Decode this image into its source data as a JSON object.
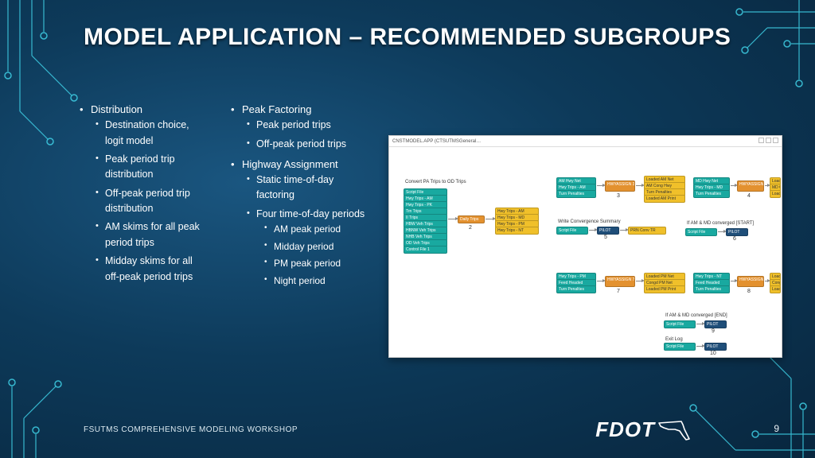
{
  "title": "MODEL APPLICATION – RECOMMENDED SUBGROUPS",
  "columns": [
    {
      "heading": "Distribution",
      "items": [
        "Destination choice, logit model",
        "Peak period trip distribution",
        "Off-peak period trip distribution",
        "AM skims for all peak period trips",
        "Midday skims for all off-peak period trips"
      ]
    },
    {
      "heading": "Peak Factoring",
      "items": [
        "Peak period trips",
        "Off-peak period trips"
      ]
    },
    {
      "heading": "Highway Assignment",
      "items": [
        "Static time-of-day factoring",
        {
          "text": "Four time-of-day periods",
          "sub": [
            "AM peak period",
            "Midday period",
            "PM peak period",
            "Night period"
          ]
        }
      ]
    }
  ],
  "flowchart": {
    "window_title": "CNSTMODEL.APP (CTSUTMSGeneral…",
    "sections": {
      "convert": {
        "title": "Convert PA Trips to OD Trips",
        "inputs": [
          "Script File",
          "Hwy Trips - AM",
          "Hwy Trips - PK",
          "Trn Trips",
          "II Trips",
          "HBW Veh Trips",
          "HBNW Veh Trips",
          "NHB Veh Trips",
          "OD Veh Trips",
          "Control File 1"
        ],
        "proc": "Daily Trips",
        "outputs": [
          "Hwy Trips - AM",
          "Hwy Trips - MD",
          "Hwy Trips - PM",
          "Hwy Trips - NT"
        ]
      },
      "top_right_1": {
        "inputs": [
          "AM Hwy Net",
          "Hwy Trips - AM",
          "Turn Penalties"
        ],
        "proc": "HWYASSIGN 3",
        "outputs": [
          "Loaded AM Net",
          "AM Cong Hwy",
          "Turn Penalties",
          "Loaded AM Print"
        ]
      },
      "top_right_2": {
        "inputs": [
          "MD Hwy Net",
          "Hwy Trips - MD",
          "Turn Penalties"
        ],
        "proc": "HWYASSIGN 4",
        "outputs": [
          "Loaded MD Net",
          "MD Cong Hwy",
          "Loaded MD Print"
        ]
      },
      "convergence": {
        "title": "Write Convergence Summary",
        "inputs": [
          "Script File"
        ],
        "proc": "PILOT",
        "outputs": [
          "PRN Conv TR"
        ]
      },
      "start": {
        "title": "If AM & MD converged [START]",
        "inputs": [
          "Script File"
        ],
        "proc": "PILOT"
      },
      "bottom_1": {
        "inputs": [
          "Hwy Trips - PM",
          "Feed Headed",
          "Turn Penalties"
        ],
        "proc": "HWYASSIGN 7",
        "outputs": [
          "Loaded PM Net",
          "Congd PM Net",
          "Loaded PM Print"
        ]
      },
      "bottom_2": {
        "inputs": [
          "Hwy Trips - NT",
          "Feed Headed",
          "Turn Penalties"
        ],
        "proc": "HWYASSIGN 8",
        "outputs": [
          "Loaded NT Net",
          "Congd NT Net",
          "Loaded NT Print"
        ]
      },
      "end": {
        "title": "If AM & MD converged [END]",
        "inputs": [
          "Script File"
        ],
        "proc": "PILOT"
      },
      "exit": {
        "title": "Exit Log",
        "inputs": [
          "Script File"
        ],
        "proc": "PILOT"
      }
    }
  },
  "footer": "FSUTMS COMPREHENSIVE MODELING WORKSHOP",
  "page_number": "9",
  "logo_text": "FDOT"
}
